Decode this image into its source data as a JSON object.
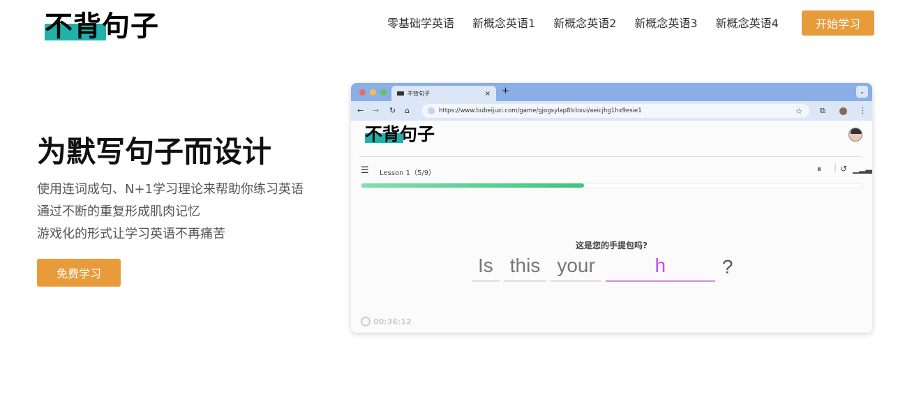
{
  "header": {
    "logo_text": "不背句子",
    "nav": [
      "零基础学英语",
      "新概念英语1",
      "新概念英语2",
      "新概念英语3",
      "新概念英语4"
    ],
    "cta_label": "开始学习"
  },
  "hero": {
    "title": "为默写句子而设计",
    "lines": [
      "使用连词成句、N+1学习理论来帮助你练习英语",
      "通过不断的重复形成肌肉记忆",
      "游戏化的形式让学习英语不再痛苦"
    ],
    "cta_label": "免费学习"
  },
  "browser": {
    "tab_title": "不背句子",
    "url": "https://www.bubeijuzi.com/game/gjogsylap8lcbxvi/aeicjhg1hx9esie1",
    "inner": {
      "logo_text": "不背句子",
      "lesson": "Lesson 1（5/9）",
      "progress": 0.445,
      "question": "这是您的手提包吗?",
      "words": [
        "Is",
        "this",
        "your",
        "h"
      ],
      "punct": "?",
      "timer": "00:36:12"
    }
  },
  "colors": {
    "accent_orange": "#e89b3a",
    "logo_highlight": "#20b2aa",
    "progress_green": "#3cc57f",
    "active_word": "#c74ee0"
  }
}
